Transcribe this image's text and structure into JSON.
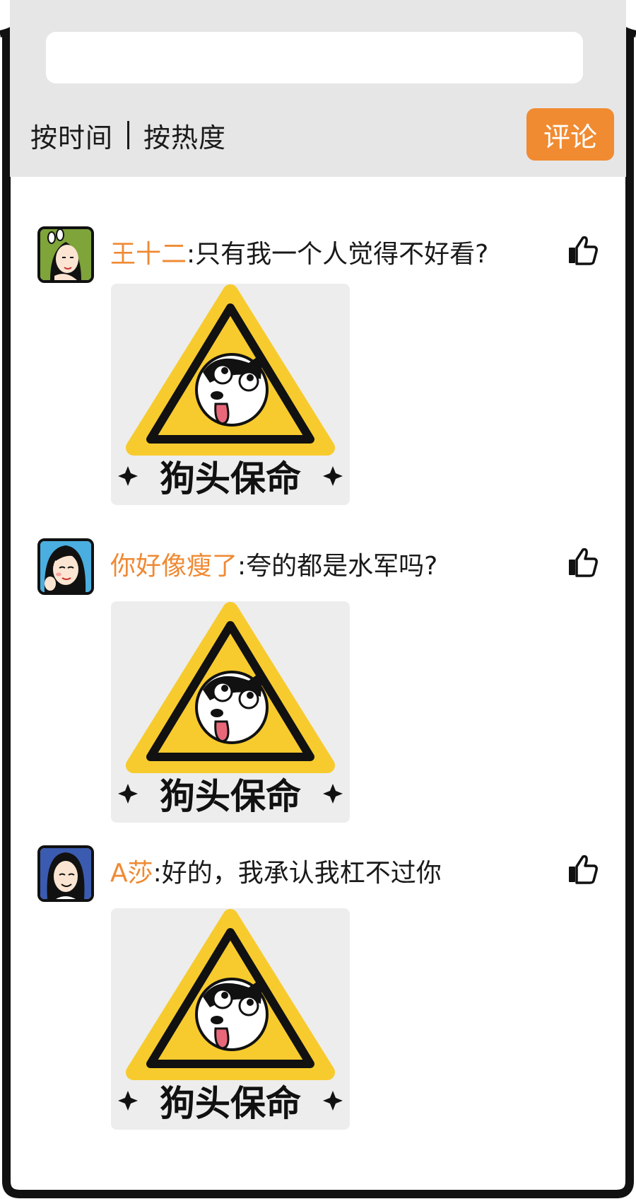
{
  "sort": {
    "by_time": "按时间",
    "by_hot": "按热度"
  },
  "comment_button": "评论",
  "comments": [
    {
      "user": "王十二",
      "text": ":只有我一个人觉得不好看?",
      "sticker_caption": "狗头保命"
    },
    {
      "user": "你好像瘦了",
      "text": ":夸的都是水军吗?",
      "sticker_caption": "狗头保命"
    },
    {
      "user": "A莎",
      "text": ":好的，我承认我杠不过你",
      "sticker_caption": "狗头保命"
    }
  ],
  "colors": {
    "accent": "#f08b32",
    "username": "#ef8a34",
    "header_bg": "#e6e6e6",
    "sticker_yellow": "#f7cb2e"
  },
  "icons": {
    "like": "thumbs-up-icon",
    "sparkle": "four-point-star-icon"
  }
}
